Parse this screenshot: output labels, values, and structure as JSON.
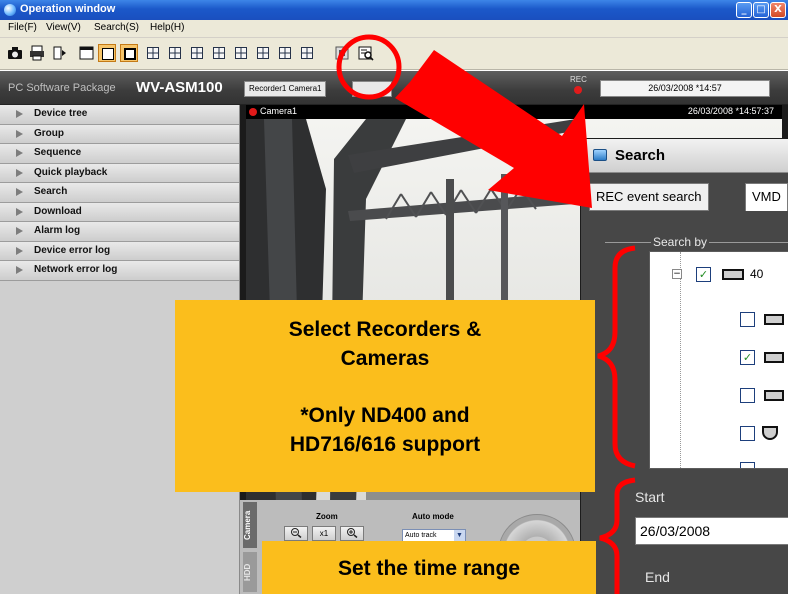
{
  "window": {
    "title": "Operation window",
    "buttons": [
      "_",
      "□",
      "X"
    ]
  },
  "menu": {
    "items": [
      "File(F)",
      "View(V)",
      "Search(S)",
      "Help(H)"
    ]
  },
  "header": {
    "package_label": "PC Software Package",
    "model": "WV-ASM100",
    "recorder_chip": "Recorder1 Camera1",
    "rec_label": "REC",
    "datetime": "26/03/2008 *14:57"
  },
  "sidebar": {
    "items": [
      {
        "label": "Device tree"
      },
      {
        "label": "Group"
      },
      {
        "label": "Sequence"
      },
      {
        "label": "Quick playback"
      },
      {
        "label": "Search"
      },
      {
        "label": "Download"
      },
      {
        "label": "Alarm log"
      },
      {
        "label": "Device error log"
      },
      {
        "label": "Network error log"
      }
    ]
  },
  "camera": {
    "name": "Camera1",
    "timestamp": "26/03/2008 *14:57:37"
  },
  "control_panel": {
    "tab_camera": "Camera",
    "tab_hdd": "HDD",
    "zoom_label": "Zoom",
    "zoom_x1": "x1",
    "auto_mode_label": "Auto mode",
    "auto_mode_value": "Auto track"
  },
  "search_dialog": {
    "title": "Search",
    "tabs": [
      "REC event search",
      "VMD"
    ],
    "search_by_label": "Search by",
    "tree": {
      "root_label": "40"
    },
    "start_label": "Start",
    "start_value": "26/03/2008",
    "end_label": "End"
  },
  "annotations": {
    "callout_recorders": [
      "Select Recorders &",
      "Cameras",
      "*Only ND400 and",
      "HD716/616 support"
    ],
    "callout_time": "Set the time range"
  },
  "colors": {
    "callout": "#fbbe1c",
    "arrow": "#ff0000",
    "titlebar": "#1b58c9"
  }
}
